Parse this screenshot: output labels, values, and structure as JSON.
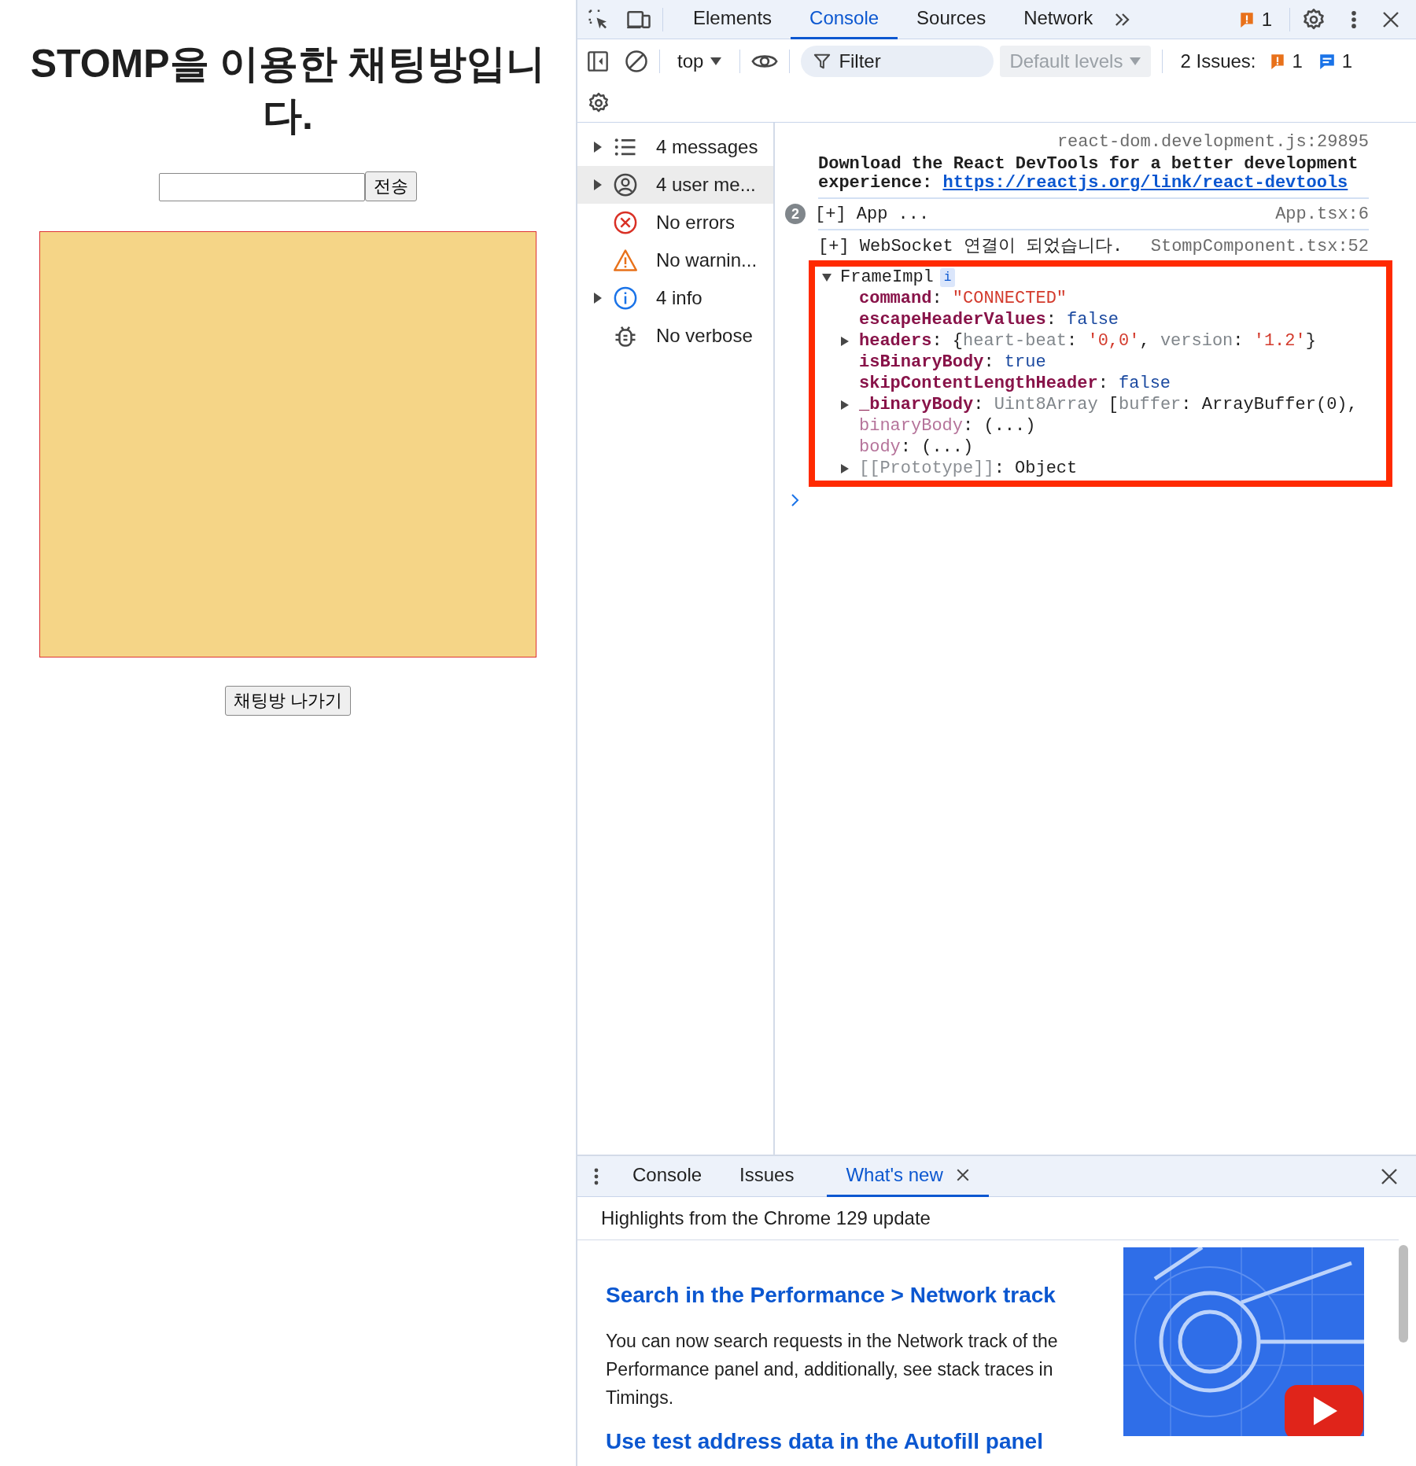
{
  "page": {
    "title": "STOMP을 이용한 채팅방입니다.",
    "send_button": "전송",
    "exit_button": "채팅방 나가기"
  },
  "devtools": {
    "tabs": [
      {
        "label": "Elements",
        "selected": false
      },
      {
        "label": "Console",
        "selected": true
      },
      {
        "label": "Sources",
        "selected": false
      },
      {
        "label": "Network",
        "selected": false
      }
    ],
    "issues_badge": "1",
    "toolbar": {
      "context": "top",
      "filter_placeholder": "Filter",
      "levels": {
        "label": "Default levels",
        "disabled": true
      },
      "issues_label": "2 Issues:",
      "warning_count": "1",
      "info_count": "1"
    },
    "sidebar": [
      {
        "kind": "messages",
        "label": "4 messages",
        "expandable": true,
        "selected": false
      },
      {
        "kind": "user",
        "label": "4 user me...",
        "expandable": true,
        "selected": true
      },
      {
        "kind": "error",
        "label": "No errors",
        "expandable": false,
        "selected": false
      },
      {
        "kind": "warning",
        "label": "No warnin...",
        "expandable": false,
        "selected": false
      },
      {
        "kind": "info",
        "label": "4 info",
        "expandable": true,
        "selected": false
      },
      {
        "kind": "verbose",
        "label": "No verbose",
        "expandable": false,
        "selected": false
      }
    ],
    "console": [
      {
        "kind": "log",
        "source": "react-dom.development.js:29895",
        "text": "Download the React DevTools for a better development experience: ",
        "link": "https://reactjs.org/link/react-devtools"
      },
      {
        "kind": "group",
        "repeat": "2",
        "text": "[+] App ...",
        "source": "App.tsx:6"
      },
      {
        "kind": "group",
        "text": "[+] WebSocket 연결이 되었습니다.",
        "source": "StompComponent.tsx:52"
      },
      {
        "kind": "object",
        "name": "FrameImpl",
        "badge": "i",
        "expanded": true,
        "highlighted": true,
        "properties": [
          {
            "key": "command",
            "kind": "own",
            "expandable": false,
            "parts": [
              {
                "text": ": ",
                "kind": "plain"
              },
              {
                "text": "\"CONNECTED\"",
                "kind": "string"
              }
            ]
          },
          {
            "key": "escapeHeaderValues",
            "kind": "own",
            "expandable": false,
            "parts": [
              {
                "text": ": ",
                "kind": "plain"
              },
              {
                "text": "false",
                "kind": "keyword"
              }
            ]
          },
          {
            "key": "headers",
            "kind": "own",
            "expandable": true,
            "parts": [
              {
                "text": ": {",
                "kind": "plain"
              },
              {
                "text": "heart-beat",
                "kind": "preview"
              },
              {
                "text": ": ",
                "kind": "plain"
              },
              {
                "text": "'0,0'",
                "kind": "string"
              },
              {
                "text": ", ",
                "kind": "plain"
              },
              {
                "text": "version",
                "kind": "preview"
              },
              {
                "text": ": ",
                "kind": "plain"
              },
              {
                "text": "'1.2'",
                "kind": "string"
              },
              {
                "text": "}",
                "kind": "plain"
              }
            ]
          },
          {
            "key": "isBinaryBody",
            "kind": "own",
            "expandable": false,
            "parts": [
              {
                "text": ": ",
                "kind": "plain"
              },
              {
                "text": "true",
                "kind": "keyword"
              }
            ]
          },
          {
            "key": "skipContentLengthHeader",
            "kind": "own",
            "expandable": false,
            "parts": [
              {
                "text": ": ",
                "kind": "plain"
              },
              {
                "text": "false",
                "kind": "keyword"
              }
            ]
          },
          {
            "key": "_binaryBody",
            "kind": "own",
            "expandable": true,
            "parts": [
              {
                "text": ": ",
                "kind": "plain"
              },
              {
                "text": "Uint8Array",
                "kind": "preview"
              },
              {
                "text": " [",
                "kind": "plain"
              },
              {
                "text": "buffer",
                "kind": "preview"
              },
              {
                "text": ": ArrayBuffer(0),",
                "kind": "plain"
              }
            ]
          },
          {
            "key": "binaryBody",
            "kind": "accessor",
            "expandable": false,
            "parts": [
              {
                "text": ": (...)",
                "kind": "plain"
              }
            ]
          },
          {
            "key": "body",
            "kind": "accessor",
            "expandable": false,
            "parts": [
              {
                "text": ": (...)",
                "kind": "plain"
              }
            ]
          },
          {
            "key": "[[Prototype]]",
            "kind": "internal",
            "expandable": true,
            "parts": [
              {
                "text": ": Object",
                "kind": "plain"
              }
            ]
          }
        ]
      }
    ],
    "drawer": {
      "tabs": [
        {
          "label": "Console",
          "selected": false,
          "closable": false
        },
        {
          "label": "Issues",
          "selected": false,
          "closable": false
        },
        {
          "label": "What's new",
          "selected": true,
          "closable": true
        }
      ],
      "heading": "Highlights from the Chrome 129 update",
      "articles": [
        {
          "title": "Search in the Performance > Network track",
          "body": "You can now search requests in the Network track of the Performance panel and, additionally, see stack traces in Timings."
        },
        {
          "title": "Use test address data in the Autofill panel"
        }
      ]
    }
  }
}
